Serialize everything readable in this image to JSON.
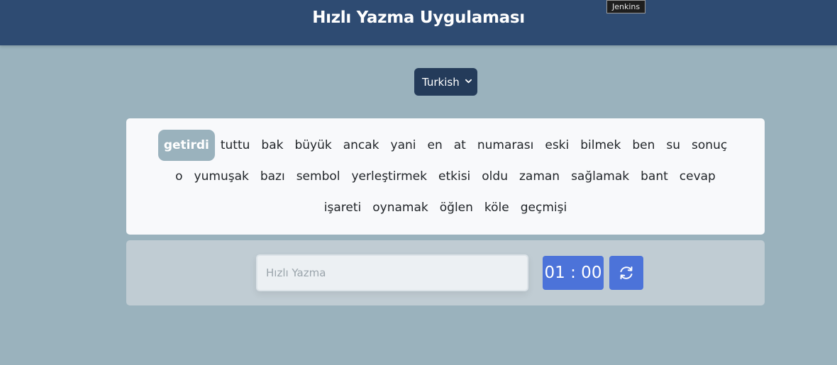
{
  "header": {
    "title": "Hızlı Yazma Uygulaması"
  },
  "tooltip": {
    "text": "Jenkins"
  },
  "language": {
    "selected": "Turkish"
  },
  "words": [
    "getirdi",
    "tuttu",
    "bak",
    "büyük",
    "ancak",
    "yani",
    "en",
    "at",
    "numarası",
    "eski",
    "bilmek",
    "ben",
    "su",
    "sonuç",
    "o",
    "yumuşak",
    "bazı",
    "sembol",
    "yerleştirmek",
    "etkisi",
    "oldu",
    "zaman",
    "sağlamak",
    "bant",
    "cevap",
    "işareti",
    "oynamak",
    "öğlen",
    "köle",
    "geçmişi"
  ],
  "active_word_index": 0,
  "input": {
    "placeholder": "Hızlı Yazma",
    "value": ""
  },
  "timer": {
    "text": "01 : 00"
  },
  "icons": {
    "refresh": "refresh-icon",
    "dropdown": "chevron-down-icon"
  },
  "colors": {
    "header": "#2e4b72",
    "accent": "#4c73d9",
    "active_word": "#9ab2bd"
  }
}
